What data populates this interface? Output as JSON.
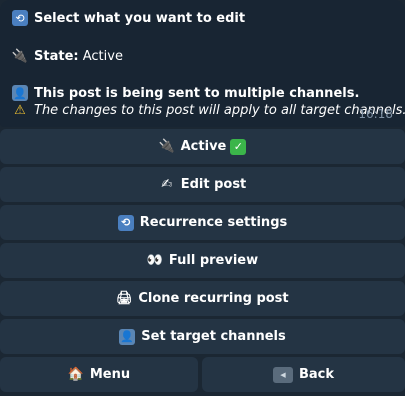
{
  "message": {
    "title": "Select what you want to edit",
    "state_label": "State:",
    "state_value": "Active",
    "multi_title": "This post is being sent to multiple channels.",
    "multi_note": "The changes to this post will apply to all target channels.",
    "time": "16:18"
  },
  "icons": {
    "repeat": "repeat-icon",
    "plug": "plug-icon",
    "person": "person-icon",
    "warning": "warning-icon"
  },
  "buttons": {
    "active": "Active",
    "edit_post": "Edit post",
    "recurrence": "Recurrence settings",
    "full_preview": "Full preview",
    "clone": "Clone recurring post",
    "set_targets": "Set target channels",
    "menu": "Menu",
    "back": "Back"
  }
}
